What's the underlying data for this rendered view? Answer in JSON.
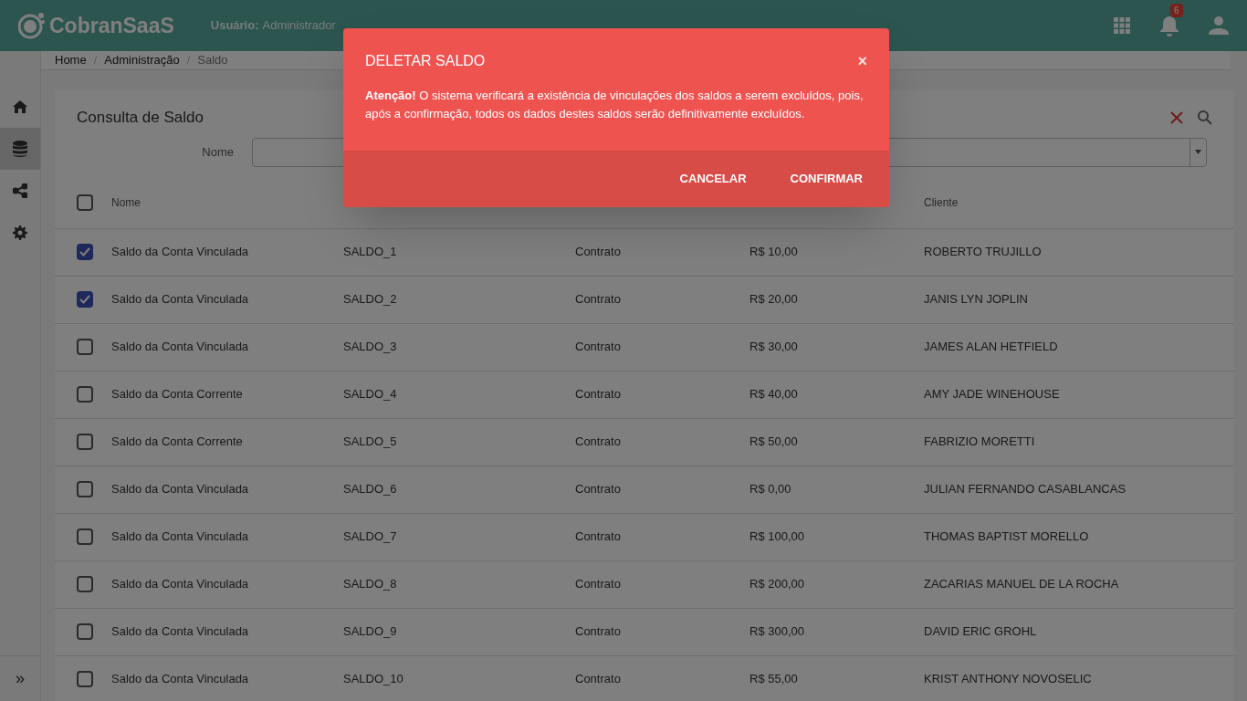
{
  "header": {
    "logo": "CobranSaaS",
    "user_label": "Usuário:",
    "user_value": "Administrador",
    "notification_count": "6"
  },
  "sidebar": {
    "items": [
      {
        "kind": "home",
        "selected": false
      },
      {
        "kind": "database",
        "selected": true
      },
      {
        "kind": "share",
        "selected": false
      },
      {
        "kind": "settings",
        "selected": false
      }
    ],
    "expand": "»"
  },
  "breadcrumb": [
    "Home",
    "Administração",
    "Saldo"
  ],
  "breadcrumb_separator": "/",
  "card": {
    "title": "Consulta de Saldo",
    "filter_label": "Nome"
  },
  "table": {
    "select_all": false,
    "columns": [
      "Nome",
      "",
      "",
      "",
      "Cliente"
    ],
    "rows": [
      {
        "checked": true,
        "cells": [
          "Saldo da Conta Vinculada",
          "SALDO_1",
          "Contrato",
          "R$ 10,00",
          "ROBERTO TRUJILLO"
        ]
      },
      {
        "checked": true,
        "cells": [
          "Saldo da Conta Vinculada",
          "SALDO_2",
          "Contrato",
          "R$ 20,00",
          "JANIS LYN JOPLIN"
        ]
      },
      {
        "checked": false,
        "cells": [
          "Saldo da Conta Vinculada",
          "SALDO_3",
          "Contrato",
          "R$ 30,00",
          "JAMES ALAN HETFIELD"
        ]
      },
      {
        "checked": false,
        "cells": [
          "Saldo da Conta Corrente",
          "SALDO_4",
          "Contrato",
          "R$ 40,00",
          "AMY JADE WINEHOUSE"
        ]
      },
      {
        "checked": false,
        "cells": [
          "Saldo da Conta Corrente",
          "SALDO_5",
          "Contrato",
          "R$ 50,00",
          "FABRIZIO MORETTI"
        ]
      },
      {
        "checked": false,
        "cells": [
          "Saldo da Conta Vinculada",
          "SALDO_6",
          "Contrato",
          "R$ 0,00",
          "JULIAN FERNANDO CASABLANCAS"
        ]
      },
      {
        "checked": false,
        "cells": [
          "Saldo da Conta Vinculada",
          "SALDO_7",
          "Contrato",
          "R$ 100,00",
          "THOMAS BAPTIST MORELLO"
        ]
      },
      {
        "checked": false,
        "cells": [
          "Saldo da Conta Vinculada",
          "SALDO_8",
          "Contrato",
          "R$ 200,00",
          "ZACARIAS MANUEL DE LA ROCHA"
        ]
      },
      {
        "checked": false,
        "cells": [
          "Saldo da Conta Vinculada",
          "SALDO_9",
          "Contrato",
          "R$ 300,00",
          "DAVID ERIC GROHL"
        ]
      },
      {
        "checked": false,
        "cells": [
          "Saldo da Conta Vinculada",
          "SALDO_10",
          "Contrato",
          "R$ 55,00",
          "KRIST ANTHONY NOVOSELIC"
        ]
      }
    ]
  },
  "dialog": {
    "title": "DELETAR SALDO",
    "close": "×",
    "message": "**Atenção!** O sistema verificará a existência de vinculações dos saldos a serem excluídos, pois, após a confirmação, todos os dados destes saldos serão definitivamente excluídos.",
    "buttons": [
      "CANCELAR",
      "CONFIRMAR"
    ]
  }
}
